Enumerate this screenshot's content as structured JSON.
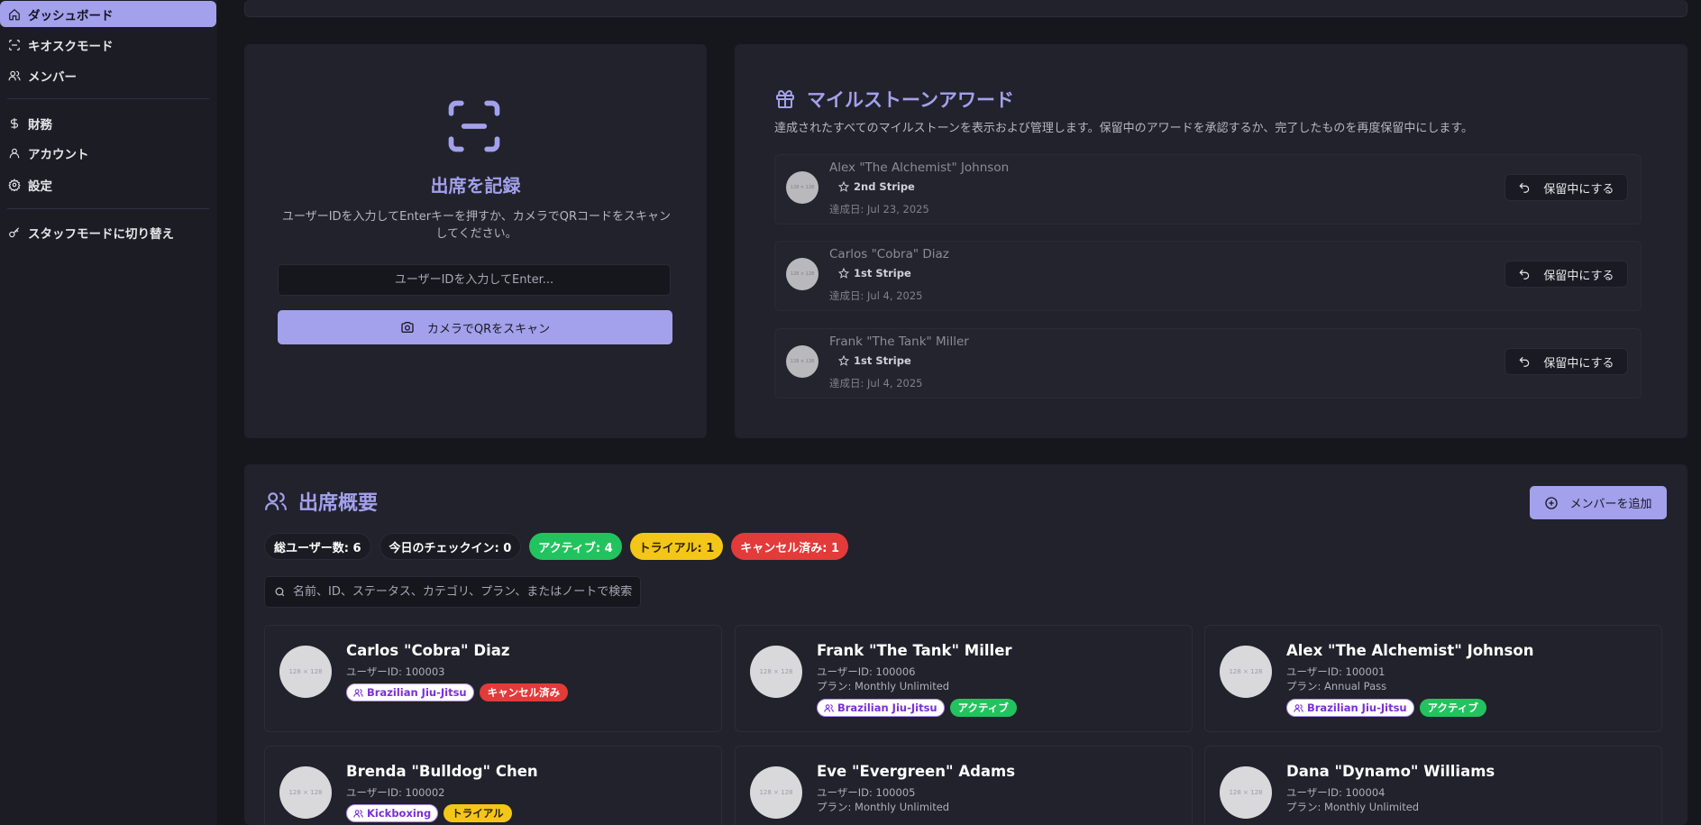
{
  "sidebar": {
    "items": [
      {
        "label": "ダッシュボード",
        "icon": "home-icon"
      },
      {
        "label": "キオスクモード",
        "icon": "scan-icon"
      },
      {
        "label": "メンバー",
        "icon": "users-icon"
      },
      {
        "label": "財務",
        "icon": "dollar-icon"
      },
      {
        "label": "アカウント",
        "icon": "user-icon"
      },
      {
        "label": "設定",
        "icon": "gear-icon"
      },
      {
        "label": "スタッフモードに切り替え",
        "icon": "key-icon"
      }
    ]
  },
  "attendance": {
    "title": "出席を記録",
    "description": "ユーザーIDを入力してEnterキーを押すか、カメラでQRコードをスキャンしてください。",
    "input_placeholder": "ユーザーIDを入力してEnter...",
    "scan_button": "カメラでQRをスキャン"
  },
  "milestones": {
    "title": "マイルストーンアワード",
    "description": "達成されたすべてのマイルストーンを表示および管理します。保留中のアワードを承認するか、完了したものを再度保留中にします。",
    "avatar_text": "128 × 128",
    "pending_label": "保留中にする",
    "items": [
      {
        "name": "Alex \"The Alchemist\" Johnson",
        "badge": "2nd Stripe",
        "date": "達成日: Jul 23, 2025"
      },
      {
        "name": "Carlos \"Cobra\" Diaz",
        "badge": "1st Stripe",
        "date": "達成日: Jul 4, 2025"
      },
      {
        "name": "Frank \"The Tank\" Miller",
        "badge": "1st Stripe",
        "date": "達成日: Jul 4, 2025"
      }
    ]
  },
  "summary": {
    "title": "出席概要",
    "add_button": "メンバーを追加",
    "stats": {
      "total": "総ユーザー数: 6",
      "today": "今日のチェックイン: 0",
      "active": "アクティブ: 4",
      "trial": "トライアル: 1",
      "cancelled": "キャンセル済み: 1"
    },
    "search_placeholder": "名前、ID、ステータス、カテゴリ、プラン、またはノートで検索",
    "avatar_text": "128 × 128",
    "members": [
      {
        "name": "Carlos \"Cobra\" Diaz",
        "uid": "ユーザーID: 100003",
        "plan": "",
        "category": "Brazilian Jiu-Jitsu",
        "status": "キャンセル済み",
        "status_color": "red"
      },
      {
        "name": "Frank \"The Tank\" Miller",
        "uid": "ユーザーID: 100006",
        "plan": "プラン: Monthly Unlimited",
        "category": "Brazilian Jiu-Jitsu",
        "status": "アクティブ",
        "status_color": "green"
      },
      {
        "name": "Alex \"The Alchemist\" Johnson",
        "uid": "ユーザーID: 100001",
        "plan": "プラン: Annual Pass",
        "category": "Brazilian Jiu-Jitsu",
        "status": "アクティブ",
        "status_color": "green"
      },
      {
        "name": "Brenda \"Bulldog\" Chen",
        "uid": "ユーザーID: 100002",
        "plan": "",
        "category": "Kickboxing",
        "status": "トライアル",
        "status_color": "yellow"
      },
      {
        "name": "Eve \"Evergreen\" Adams",
        "uid": "ユーザーID: 100005",
        "plan": "プラン: Monthly Unlimited",
        "category": "",
        "status": "",
        "status_color": "green"
      },
      {
        "name": "Dana \"Dynamo\" Williams",
        "uid": "ユーザーID: 100004",
        "plan": "プラン: Monthly Unlimited",
        "category": "",
        "status": "",
        "status_color": "green"
      }
    ]
  },
  "colors": {
    "accent": "#a3a0ec",
    "green": "#22c35e",
    "yellow": "#f4c617",
    "red": "#e33a3a"
  }
}
